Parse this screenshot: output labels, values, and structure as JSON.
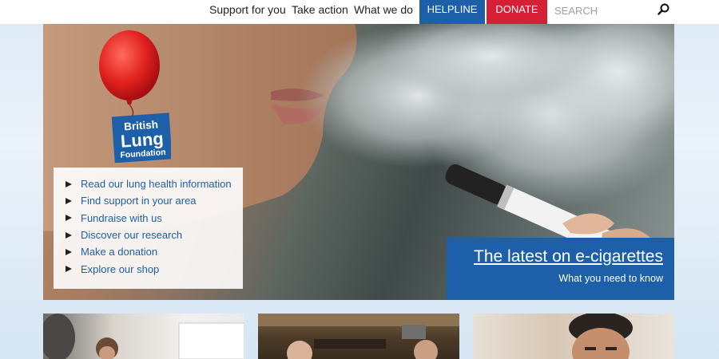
{
  "nav": {
    "links": [
      "Support for you",
      "Take action",
      "What we do"
    ],
    "helpline": "HELPLINE",
    "donate": "DONATE",
    "search_placeholder": "SEARCH"
  },
  "logo": {
    "line1": "British",
    "line2": "Lung",
    "line3": "Foundation"
  },
  "hero": {
    "menu": [
      "Read our lung health information",
      "Find support in your area",
      "Fundraise with us",
      "Discover our research",
      "Make a donation",
      "Explore our shop"
    ],
    "feature_title": "The latest on e-cigarettes",
    "feature_subtitle": "What you need to know"
  },
  "cards": [
    {
      "image": "woman-at-whiteboard-photo"
    },
    {
      "image": "people-in-pub-photo"
    },
    {
      "image": "smiling-man-photo"
    }
  ],
  "colors": {
    "brand_blue": "#1d5fa8",
    "donate_red": "#d41f35",
    "balloon_red": "#e2221f"
  },
  "icons": {
    "search": "search-icon",
    "menu_bullet": "triangle-right-icon",
    "balloon": "red-balloon-icon"
  }
}
